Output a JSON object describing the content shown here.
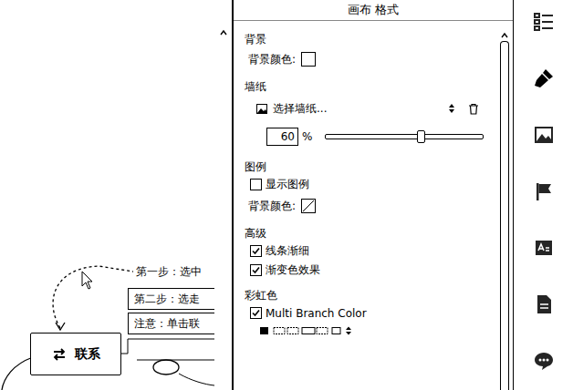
{
  "canvas": {
    "nodes": [
      {
        "text": "第一步：选中",
        "kind": "plain"
      },
      {
        "text": "第二步：选走",
        "kind": "boxed"
      },
      {
        "text": "注意：单击联",
        "kind": "boxed"
      }
    ],
    "central": {
      "label": "联系"
    }
  },
  "panel": {
    "title": "画布 格式",
    "sections": [
      {
        "heading": "背景",
        "rows": [
          {
            "kind": "color",
            "label": "背景颜色:",
            "none": false
          }
        ]
      },
      {
        "heading": "墙纸",
        "rows": [
          {
            "kind": "dropdown",
            "value": "选择墙纸..."
          },
          {
            "kind": "slider",
            "value": "60",
            "unit": "%",
            "level": 0.6
          }
        ]
      },
      {
        "heading": "图例",
        "rows": [
          {
            "kind": "checkbox",
            "label": "显示图例",
            "checked": false
          },
          {
            "kind": "color",
            "label": "背景颜色:",
            "none": true
          }
        ]
      },
      {
        "heading": "高级",
        "rows": [
          {
            "kind": "checkbox",
            "label": "线条渐细",
            "checked": true
          },
          {
            "kind": "checkbox",
            "label": "渐变色效果",
            "checked": true
          }
        ]
      },
      {
        "heading": "彩虹色",
        "rows": [
          {
            "kind": "checkbox",
            "label": "Multi Branch Color",
            "checked": true
          },
          {
            "kind": "swatches"
          }
        ]
      }
    ]
  },
  "sidebar": {
    "tabs": [
      {
        "selected": false
      },
      {
        "selected": true
      },
      {
        "selected": false
      },
      {
        "selected": false
      },
      {
        "selected": false
      },
      {
        "selected": false
      },
      {
        "selected": false
      }
    ]
  }
}
